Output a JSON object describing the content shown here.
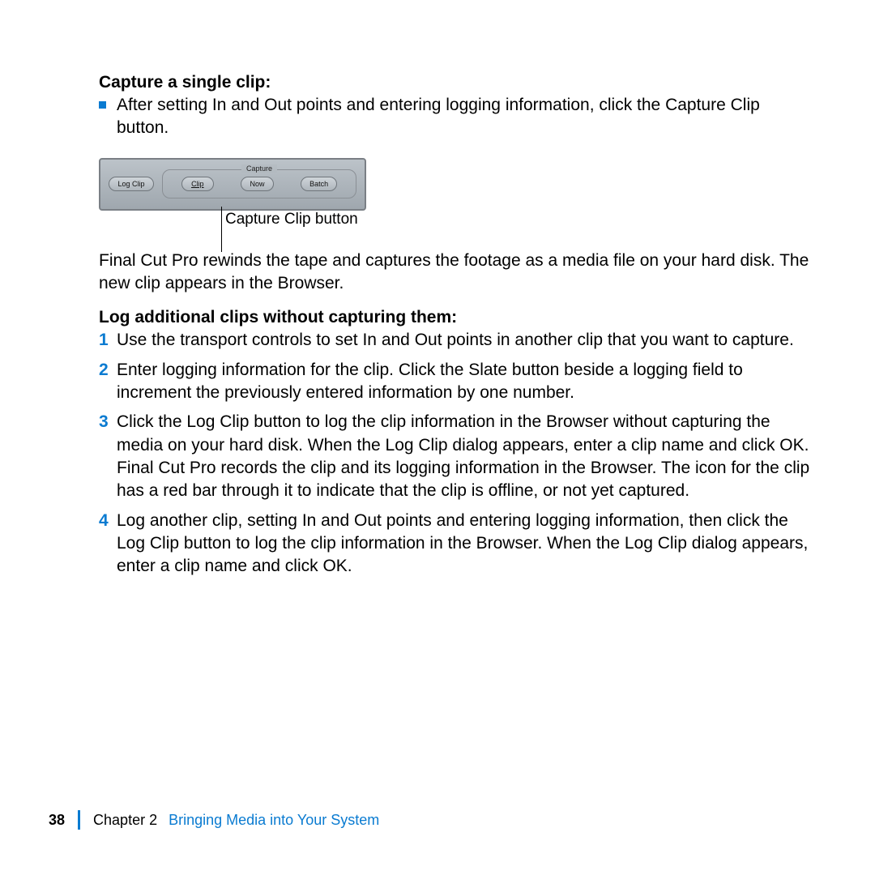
{
  "section1": {
    "heading": "Capture a single clip:",
    "bullet_text": "After setting In and Out points and entering logging information, click the Capture Clip button."
  },
  "panel": {
    "log_clip": "Log Clip",
    "fieldset_label": "Capture",
    "clip": "Clip",
    "now": "Now",
    "batch": "Batch"
  },
  "callout": "Capture Clip button",
  "para_after_panel": "Final Cut Pro rewinds the tape and captures the footage as a media file on your hard disk. The new clip appears in the Browser.",
  "section2": {
    "heading": "Log additional clips without capturing them:",
    "items": [
      "Use the transport controls to set In and Out points in another clip that you want to capture.",
      "Enter logging information for the clip. Click the Slate button beside a logging field to increment the previously entered information by one number.",
      "Click the Log Clip button to log the clip information in the Browser without capturing the media on your hard disk. When the Log Clip dialog appears, enter a clip name and click OK. Final Cut Pro records the clip and its logging information in the Browser. The icon for the clip has a red bar through it to indicate that the clip is offline, or not yet captured.",
      "Log another clip, setting In and Out points and entering logging information, then click the Log Clip button to log the clip information in the Browser. When the Log Clip dialog appears, enter a clip name and click OK."
    ]
  },
  "footer": {
    "page": "38",
    "chapter": "Chapter 2",
    "title": "Bringing Media into Your System"
  }
}
